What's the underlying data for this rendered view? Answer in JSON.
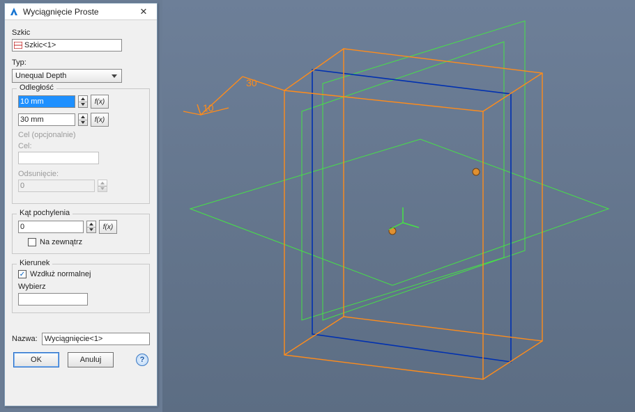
{
  "dialog": {
    "title": "Wyciągnięcie Proste",
    "close_glyph": "✕",
    "szkic_label": "Szkic",
    "szkic_value": "Szkic<1>",
    "typ_label": "Typ:",
    "typ_value": "Unequal Depth",
    "odleglosc": {
      "legend": "Odległość",
      "dist1": "10 mm",
      "dist2": "30 mm",
      "fx": "f(x)"
    },
    "cel": {
      "legend": "Cel (opcjonalnie)",
      "cel_label": "Cel:",
      "odsuniecie_label": "Odsunięcie:",
      "odsuniecie_value": "0"
    },
    "kat": {
      "legend": "Kąt pochylenia",
      "value": "0",
      "fx": "f(x)",
      "na_zewnatrz": "Na zewnątrz"
    },
    "kierunek": {
      "legend": "Kierunek",
      "wzdluz": "Wzdłuż normalnej",
      "wybierz": "Wybierz"
    },
    "nazwa_label": "Nazwa:",
    "nazwa_value": "Wyciągnięcie<1>",
    "ok": "OK",
    "anuluj": "Anuluj",
    "help": "?"
  },
  "viewport": {
    "dim1": "30",
    "dim2": "10",
    "colors": {
      "orange": "#ff8c1a",
      "green": "#46e246",
      "blue": "#0030b0"
    }
  }
}
